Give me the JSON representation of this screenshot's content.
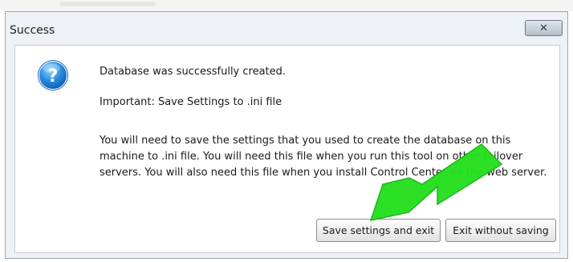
{
  "dialog": {
    "title": "Success",
    "close_glyph": "✕"
  },
  "message": {
    "line1": "Database was successfully created.",
    "line2": "Important: Save Settings to .ini file",
    "line3": "You will need to save the settings that you used to create the database on this machine to .ini file. You will need this file when you run this tool on other failover servers. You will also need this file when you install Control Center on the web server."
  },
  "buttons": {
    "save_label": "Save settings and exit",
    "exit_label": "Exit without saving"
  },
  "icons": {
    "dialog_icon": "question-icon",
    "annotation": "green-arrow-annotation"
  },
  "colors": {
    "arrow": "#22e51e",
    "icon_blue": "#1c82d6"
  }
}
